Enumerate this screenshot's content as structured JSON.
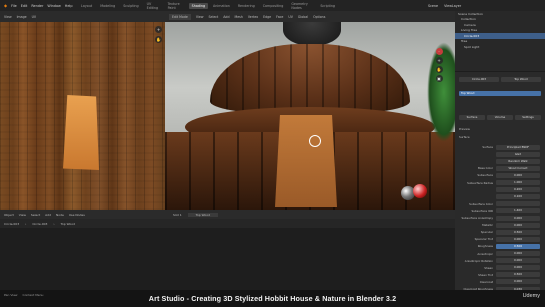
{
  "menu": [
    "File",
    "Edit",
    "Render",
    "Window",
    "Help"
  ],
  "workspace_tabs": [
    "Layout",
    "Modeling",
    "Sculpting",
    "UV Editing",
    "Texture Paint",
    "Shading",
    "Animation",
    "Rendering",
    "Compositing",
    "Geometry Nodes",
    "Scripting"
  ],
  "active_tab": "Shading",
  "right_top": {
    "scene": "Scene",
    "view_layer": "ViewLayer"
  },
  "uv_header": [
    "View",
    "Image",
    "UV"
  ],
  "viewport_header": {
    "mode": "Edit Mode",
    "items": [
      "View",
      "Select",
      "Add",
      "Mesh",
      "Vertex",
      "Edge",
      "Face",
      "UV"
    ],
    "shading": "Global",
    "options": "Options"
  },
  "uv_footer": [
    "Object",
    "View",
    "Select",
    "Add",
    "Node",
    "Use Nodes"
  ],
  "viewport_footer": {
    "slot": "Slot 1",
    "material": "Top Wood"
  },
  "breadcrumb": [
    "Circle.003",
    "Circle.003",
    "Top Wood"
  ],
  "outliner": {
    "rows": [
      {
        "label": "Scene Collection",
        "selected": false
      },
      {
        "label": "Collection",
        "selected": false
      },
      {
        "label": "Camera",
        "selected": false
      },
      {
        "label": "Living Tree",
        "selected": false
      },
      {
        "label": "Circle.003",
        "selected": true
      },
      {
        "label": "Tree",
        "selected": false
      },
      {
        "label": "Spot Light",
        "selected": false
      }
    ]
  },
  "properties": {
    "object": "Circle.003",
    "material_slot": "Top Wood",
    "material": "Top Wood",
    "tabs": [
      "Surface",
      "Volume",
      "Settings"
    ],
    "sections": [
      "Preview",
      "Surface"
    ],
    "rows": [
      {
        "label": "Surface",
        "value": "Principled BSDF"
      },
      {
        "label": "",
        "value": "GGX"
      },
      {
        "label": "",
        "value": "Random Walk"
      },
      {
        "label": "Base Color",
        "value": "Wood Correct"
      },
      {
        "label": "Subsurface",
        "value": "0.000"
      },
      {
        "label": "Subsurface Radius",
        "value": "1.000"
      },
      {
        "label": "",
        "value": "0.200"
      },
      {
        "label": "",
        "value": "0.100"
      },
      {
        "label": "Subsurface Color",
        "value": ""
      },
      {
        "label": "Subsurface IOR",
        "value": "1.400"
      },
      {
        "label": "Subsurface Anisotropy",
        "value": "0.000"
      },
      {
        "label": "Metallic",
        "value": "0.000"
      },
      {
        "label": "Specular",
        "value": "0.500"
      },
      {
        "label": "Specular Tint",
        "value": "0.000"
      },
      {
        "label": "Roughness",
        "value": "0.506"
      },
      {
        "label": "Anisotropic",
        "value": "0.000"
      },
      {
        "label": "Anisotropic Rotation",
        "value": "0.000"
      },
      {
        "label": "Sheen",
        "value": "0.000"
      },
      {
        "label": "Sheen Tint",
        "value": "0.500"
      },
      {
        "label": "Clearcoat",
        "value": "0.000"
      },
      {
        "label": "Clearcoat Roughness",
        "value": "0.030"
      }
    ]
  },
  "status_left": [
    "Pan View",
    "Context Menu"
  ],
  "caption": "Art Studio - Creating 3D Stylized Hobbit House & Nature in Blender 3.2",
  "watermark": "Udemy"
}
